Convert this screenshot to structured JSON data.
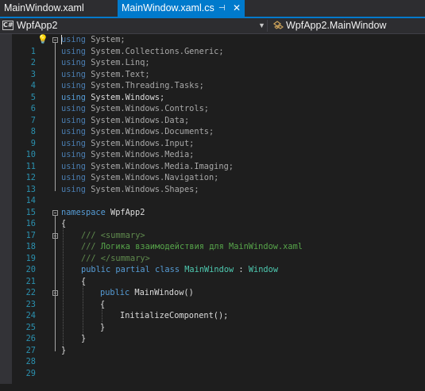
{
  "tabs": {
    "inactive_label": "MainWindow.xaml",
    "active_label": "MainWindow.xaml.cs",
    "pin_glyph": "⊣",
    "close_glyph": "✕"
  },
  "navbar": {
    "csharp_badge": "C#",
    "project": "WpfApp2",
    "type_member": "WpfApp2.MainWindow",
    "dropdown_glyph": "▼"
  },
  "colors": {
    "accent": "#007acc",
    "keyword": "#569cd6",
    "type": "#4ec9b0",
    "comment": "#57a64a",
    "line_number": "#2b91af"
  },
  "editor": {
    "line_numbers": [
      "1",
      "2",
      "3",
      "4",
      "5",
      "6",
      "7",
      "8",
      "9",
      "10",
      "11",
      "12",
      "13",
      "14",
      "15",
      "16",
      "17",
      "18",
      "19",
      "20",
      "21",
      "22",
      "23",
      "24",
      "25",
      "26",
      "27",
      "28",
      "29"
    ],
    "lines": {
      "l1": [
        "using",
        " System;"
      ],
      "l2": [
        "using",
        " System.Collections.Generic;"
      ],
      "l3": [
        "using",
        " System.Linq;"
      ],
      "l4": [
        "using",
        " System.Text;"
      ],
      "l5": [
        "using",
        " System.Threading.Tasks;"
      ],
      "l6": [
        "using",
        " System.Windows;"
      ],
      "l7": [
        "using",
        " System.Windows.Controls;"
      ],
      "l8": [
        "using",
        " System.Windows.Data;"
      ],
      "l9": [
        "using",
        " System.Windows.Documents;"
      ],
      "l10": [
        "using",
        " System.Windows.Input;"
      ],
      "l11": [
        "using",
        " System.Windows.Media;"
      ],
      "l12": [
        "using",
        " System.Windows.Media.Imaging;"
      ],
      "l13": [
        "using",
        " System.Windows.Navigation;"
      ],
      "l14": [
        "using",
        " System.Windows.Shapes;"
      ],
      "l16": [
        "namespace",
        " WpfApp2"
      ],
      "l17": "{",
      "l18": [
        "///",
        " <summary>"
      ],
      "l19": [
        "///",
        " Логика взаимодействия для MainWindow.xaml"
      ],
      "l20": [
        "///",
        " </summary>"
      ],
      "l21": [
        "public",
        " ",
        "partial",
        " ",
        "class",
        " ",
        "MainWindow",
        " : ",
        "Window"
      ],
      "l22": "{",
      "l23": [
        "public",
        " MainWindow()"
      ],
      "l24": "{",
      "l25": "InitializeComponent();",
      "l26": "}",
      "l27": "}",
      "l28": "}"
    }
  }
}
